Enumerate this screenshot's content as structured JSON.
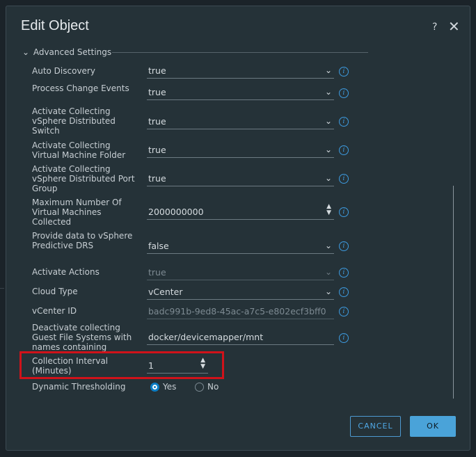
{
  "dialog": {
    "title": "Edit Object",
    "help_icon": "?",
    "close_icon": "✕",
    "section_title": "Advanced Settings"
  },
  "fields": [
    {
      "label": "Auto Discovery",
      "value": "true",
      "control": "select",
      "disabled": false
    },
    {
      "label": "Process Change Events",
      "value": "true",
      "control": "select",
      "disabled": false
    },
    {
      "label": "Activate Collecting vSphere Distributed Switch",
      "value": "true",
      "control": "select",
      "disabled": false
    },
    {
      "label": "Activate Collecting Virtual Machine Folder",
      "value": "true",
      "control": "select",
      "disabled": false
    },
    {
      "label": "Activate Collecting vSphere Distributed Port Group",
      "value": "true",
      "control": "select",
      "disabled": false
    },
    {
      "label": "Maximum Number Of Virtual Machines Collected",
      "value": "2000000000",
      "control": "number",
      "disabled": false
    },
    {
      "label": "Provide data to vSphere Predictive DRS",
      "value": "false",
      "control": "select",
      "disabled": false
    },
    {
      "label": "Activate Actions",
      "value": "true",
      "control": "select",
      "disabled": true
    },
    {
      "label": "Cloud Type",
      "value": "vCenter",
      "control": "select",
      "disabled": false
    },
    {
      "label": "vCenter ID",
      "value": "badc991b-9ed8-45ac-a7c5-e802ecf3bff0",
      "control": "text",
      "disabled": true
    },
    {
      "label": "Deactivate collecting Guest File Systems with names containing",
      "value": "docker/devicemapper/mnt",
      "control": "text",
      "disabled": false
    },
    {
      "label": "Collection Interval (Minutes)",
      "value": "1",
      "control": "number",
      "disabled": false
    }
  ],
  "dynamic_thresholding": {
    "label": "Dynamic Thresholding",
    "options": [
      "Yes",
      "No"
    ],
    "selected": "Yes"
  },
  "buttons": {
    "cancel": "CANCEL",
    "ok": "OK"
  },
  "icons": {
    "info": "info-icon",
    "dropdown": "chevron-down-icon",
    "spinner": "spinner-arrows-icon"
  },
  "colors": {
    "background": "#253238",
    "accent": "#4aa3d9",
    "highlight": "#d0121a",
    "radio_selected": "#0b7dc4"
  }
}
